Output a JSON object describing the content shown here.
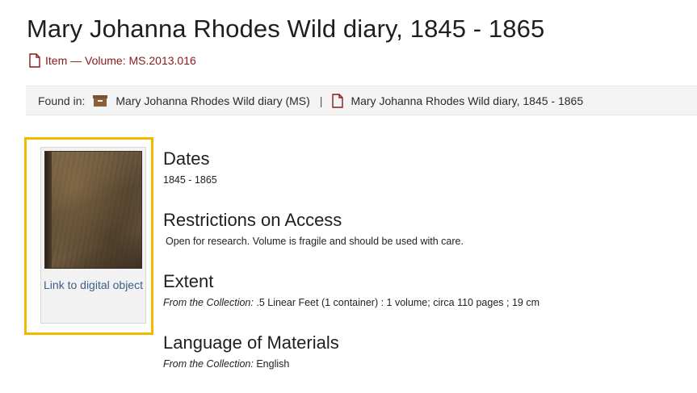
{
  "page": {
    "title": "Mary Johanna Rhodes Wild diary, 1845 - 1865",
    "item_line": "Item — Volume: MS.2013.016"
  },
  "found_in": {
    "label": "Found in:",
    "crumbs": [
      {
        "label": "Mary Johanna Rhodes Wild diary (MS)",
        "icon": "archive-box-icon"
      },
      {
        "label": "Mary Johanna Rhodes Wild diary, 1845 - 1865",
        "icon": "document-icon"
      }
    ],
    "separator": "|"
  },
  "thumbnail": {
    "link_label": "Link to digital object"
  },
  "sections": {
    "dates": {
      "heading": "Dates",
      "value": "1845 - 1865"
    },
    "restrictions": {
      "heading": "Restrictions on Access",
      "value": "Open for research. Volume is fragile and should be used with care."
    },
    "extent": {
      "heading": "Extent",
      "prefix": "From the Collection:",
      "value": ".5 Linear Feet (1 container) : 1 volume; circa 110 pages ; 19 cm"
    },
    "language": {
      "heading": "Language of Materials",
      "prefix": "From the Collection:",
      "value": "English"
    }
  },
  "colors": {
    "accent_red": "#8b1a1a",
    "link_blue": "#3b5f86",
    "highlight": "#f2b800",
    "bar_bg": "#f4f4f4"
  }
}
